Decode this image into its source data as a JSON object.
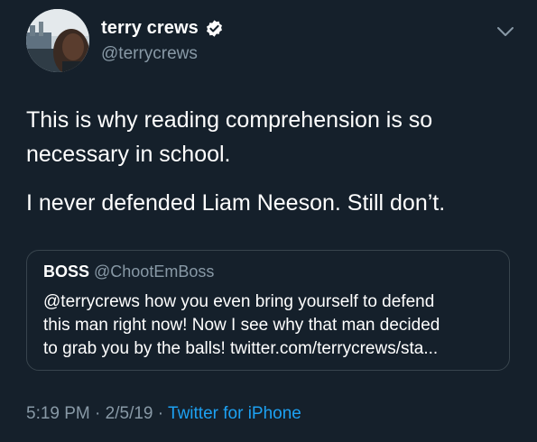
{
  "author": {
    "display_name": "terry crews",
    "handle": "@terrycrews",
    "verified": true
  },
  "tweet": {
    "paragraphs": [
      "This is why reading comprehension is so necessary in school.",
      "I never defended Liam Neeson. Still don’t."
    ]
  },
  "quoted_tweet": {
    "display_name": "BOSS",
    "handle": "@ChootEmBoss",
    "lines": [
      "@terrycrews  how you even bring yourself to defend",
      "this man right now! Now I see why that man decided",
      "to grab you by the balls! twitter.com/terrycrews/sta..."
    ]
  },
  "meta": {
    "time": "5:19 PM",
    "date": "2/5/19",
    "separator": "·",
    "source": "Twitter for iPhone"
  },
  "icons": {
    "verified": "verified-badge-icon",
    "menu": "chevron-down-icon"
  },
  "colors": {
    "background": "#15202b",
    "secondary_text": "#8899a6",
    "link": "#1da1f2",
    "border": "#38444d"
  }
}
